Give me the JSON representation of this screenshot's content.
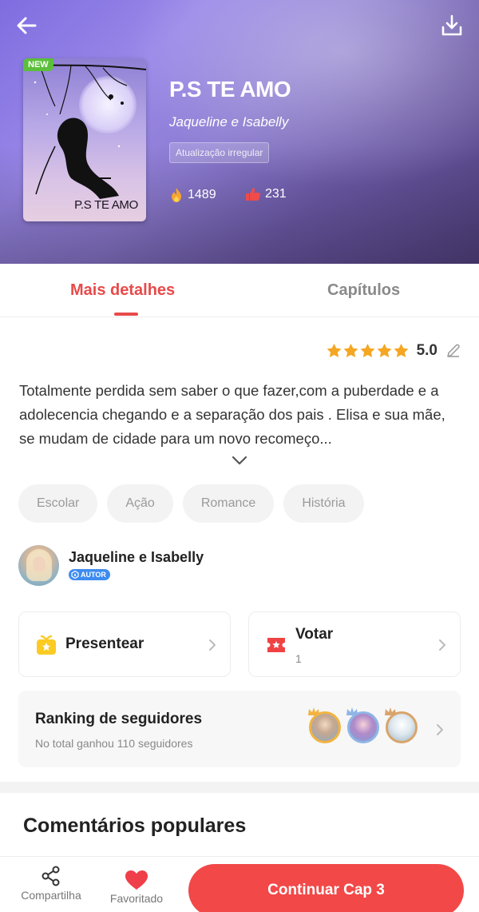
{
  "book": {
    "badge": "NEW",
    "cover_title": "P.S TE AMO",
    "title": "P.S TE AMO",
    "author": "Jaqueline e Isabelly",
    "update_status": "Atualização irregular",
    "fire_count": "1489",
    "likes_count": "231"
  },
  "tabs": [
    {
      "label": "Mais detalhes",
      "active": true
    },
    {
      "label": "Capítulos",
      "active": false
    }
  ],
  "rating": {
    "stars": 5,
    "value": "5.0"
  },
  "description": "Totalmente perdida sem saber o que fazer,com a puberdade e a adolecencia chegando e a separação dos pais . Elisa e sua mãe, se mudam de cidade para um novo recomeço...",
  "tags": [
    "Escolar",
    "Ação",
    "Romance",
    "História"
  ],
  "author": {
    "name": "Jaqueline e Isabelly",
    "badge": "AUTOR"
  },
  "actions": {
    "gift_label": "Presentear",
    "vote_label": "Votar",
    "vote_count": "1"
  },
  "ranking": {
    "title": "Ranking de seguidores",
    "subtitle": "No total ganhou 110 seguidores"
  },
  "comments_title": "Comentários populares",
  "bottom_bar": {
    "share_label": "Compartilha",
    "favorite_label": "Favoritado",
    "continue_label": "Continuar Cap 3"
  },
  "colors": {
    "accent": "#e84a4a",
    "button": "#f24848",
    "new_badge": "#5bbf3b",
    "star": "#f5a623",
    "author_badge": "#3d8bf0"
  }
}
